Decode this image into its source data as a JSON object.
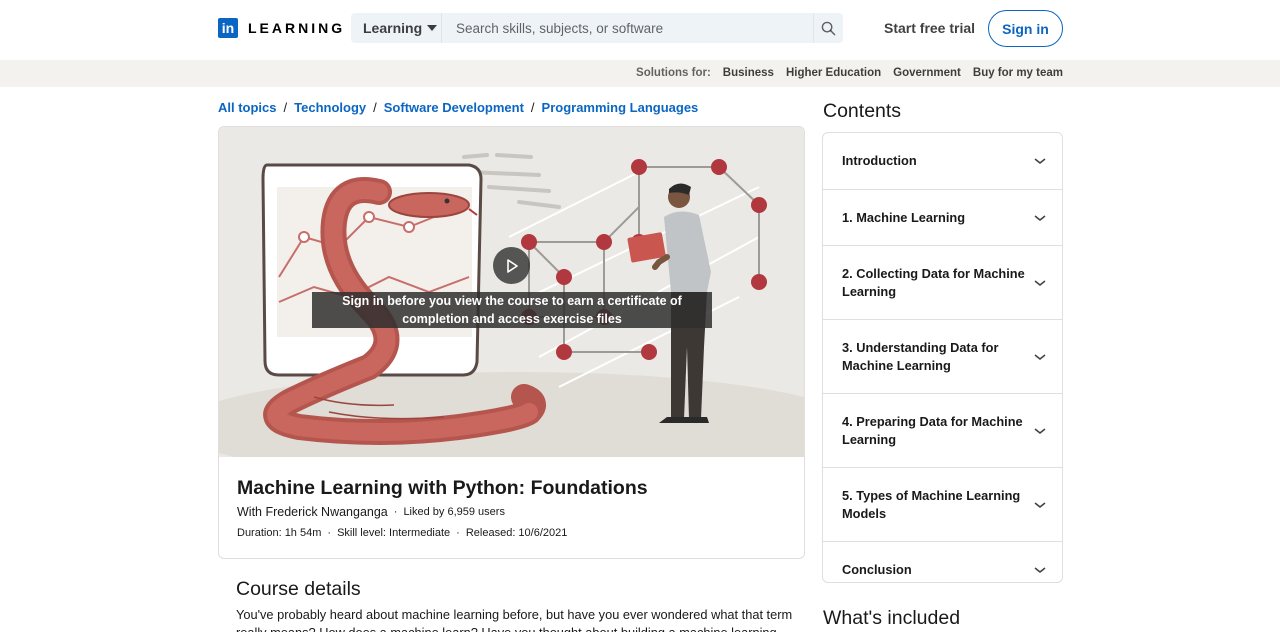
{
  "header": {
    "logo_letters": "in",
    "logo_text": "LEARNING",
    "search_dropdown": "Learning",
    "search_placeholder": "Search skills, subjects, or software",
    "start_trial": "Start free trial",
    "sign_in": "Sign in"
  },
  "subbar": {
    "label": "Solutions for:",
    "items": [
      "Business",
      "Higher Education",
      "Government",
      "Buy for my team"
    ]
  },
  "breadcrumb": [
    "All topics",
    "Technology",
    "Software Development",
    "Programming Languages"
  ],
  "video": {
    "message": "Sign in before you view the course to earn a certificate of completion and access exercise files"
  },
  "course": {
    "title": "Machine Learning with Python: Foundations",
    "instructor": "With Frederick Nwanganga",
    "liked": "Liked by 6,959 users",
    "duration": "Duration: 1h 54m",
    "skill": "Skill level: Intermediate",
    "released": "Released: 10/6/2021"
  },
  "details": {
    "title": "Course details",
    "text": "You've probably heard about machine learning before, but have you ever wondered what that term really means? How does a machine learn? Have you thought about building a machine learning model"
  },
  "contents": {
    "title": "Contents",
    "items": [
      "Introduction",
      "1. Machine Learning",
      "2. Collecting Data for Machine Learning",
      "3. Understanding Data for Machine Learning",
      "4. Preparing Data for Machine Learning",
      "5. Types of Machine Learning Models",
      "Conclusion"
    ]
  },
  "whats_included": "What's included",
  "colors": {
    "brand": "#0a66c2",
    "subbar_bg": "#f3f2ef",
    "search_bg": "#eef3f8"
  }
}
